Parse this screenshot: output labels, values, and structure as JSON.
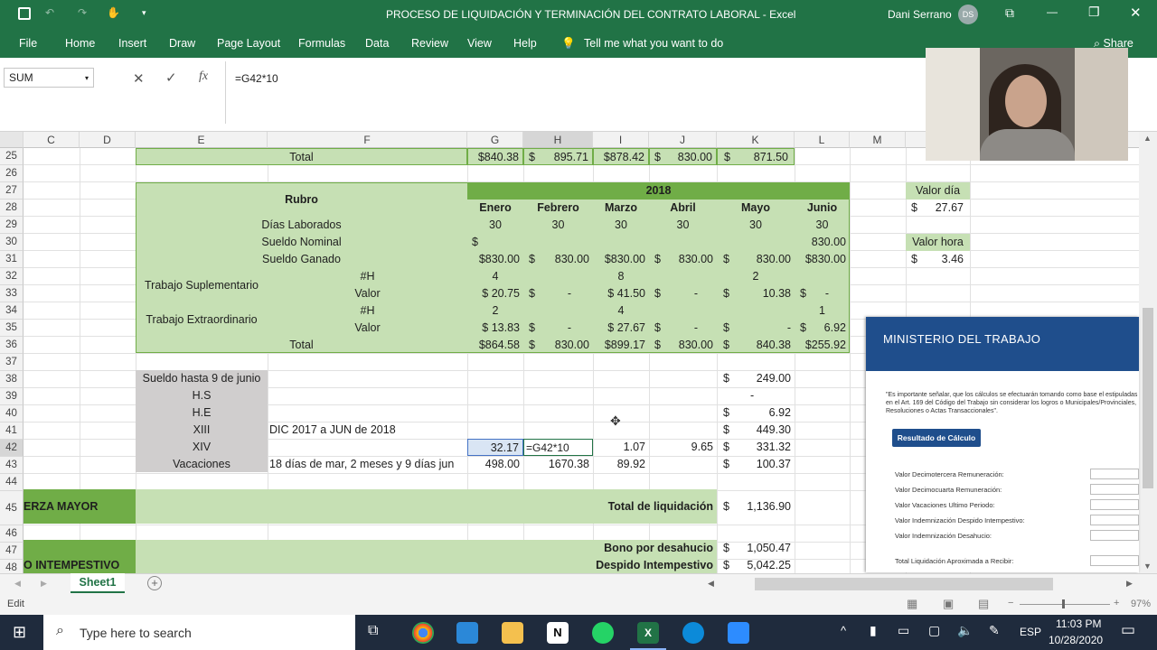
{
  "title": {
    "doc": "PROCESO DE LIQUIDACIÓN Y TERMINACIÓN DEL CONTRATO LABORAL",
    "sep": "-",
    "app": "Excel",
    "user": "Dani Serrano",
    "initials": "DS"
  },
  "menu": [
    "File",
    "Home",
    "Insert",
    "Draw",
    "Page Layout",
    "Formulas",
    "Data",
    "Review",
    "View",
    "Help"
  ],
  "tell_me": "Tell me what you want to do",
  "share": "Share",
  "namebox": "SUM",
  "formula": "=G42*10",
  "columns": [
    "C",
    "D",
    "E",
    "F",
    "G",
    "H",
    "I",
    "J",
    "K",
    "L",
    "M"
  ],
  "rows": [
    "25",
    "26",
    "27",
    "28",
    "29",
    "30",
    "31",
    "32",
    "33",
    "34",
    "35",
    "36",
    "37",
    "38",
    "39",
    "40",
    "41",
    "42",
    "43",
    "44",
    "45",
    "46",
    "47",
    "48"
  ],
  "cells": {
    "r25_total": "Total",
    "r25_g": "$840.38",
    "r25_h1": "$",
    "r25_h2": "895.71",
    "r25_i": "$878.42",
    "r25_j1": "$",
    "r25_j2": "830.00",
    "r25_k1": "$",
    "r25_k2": "871.50",
    "rubro": "Rubro",
    "year": "2018",
    "months": [
      "Enero",
      "Febrero",
      "Marzo",
      "Abril",
      "Mayo",
      "Junio"
    ],
    "dias_lab": "Días Laborados",
    "dias_vals": [
      "30",
      "30",
      "30",
      "30",
      "30",
      "30"
    ],
    "sueldo_nom": "Sueldo Nominal",
    "sn_dollar": "$",
    "sn_val": "830.00",
    "sueldo_gan": "Sueldo Ganado",
    "sg": [
      "$830.00",
      "$",
      "830.00",
      "$830.00",
      "$",
      "830.00",
      "$",
      "830.00",
      "$830.00"
    ],
    "trab_sup": "Trabajo Suplementario",
    "trab_ext": "Trabajo Extraordinario",
    "hh": "#H",
    "valor": "Valor",
    "r32": [
      "4",
      "8",
      "2"
    ],
    "r33": [
      "$ 20.75",
      "$",
      "-",
      "$ 41.50",
      "$",
      "-",
      "$",
      "10.38",
      "$",
      "-"
    ],
    "r34": [
      "2",
      "4",
      "1"
    ],
    "r35": [
      "$ 13.83",
      "$",
      "-",
      "$ 27.67",
      "$",
      "-",
      "$",
      "-",
      "$",
      "6.92"
    ],
    "r36_total": "Total",
    "r36": [
      "$864.58",
      "$",
      "830.00",
      "$899.17",
      "$",
      "830.00",
      "$",
      "840.38",
      "$255.92"
    ],
    "valor_dia": "Valor día",
    "vd1": "$",
    "vd2": "27.67",
    "valor_hora": "Valor hora",
    "vh1": "$",
    "vh2": "3.46",
    "l38": "Sueldo hasta 9 de junio",
    "k38a": "$",
    "k38b": "249.00",
    "l39": "H.S",
    "k39": "-",
    "l40": "H.E",
    "k40a": "$",
    "k40b": "6.92",
    "l41": "XIII",
    "f41": "DIC 2017 a JUN de 2018",
    "k41a": "$",
    "k41b": "449.30",
    "l42": "XIV",
    "g42": "32.17",
    "h42": "=G42*10",
    "i42": "1.07",
    "j42": "9.65",
    "k42a": "$",
    "k42b": "331.32",
    "l43": "Vacaciones",
    "f43": "18 días de mar, 2 meses y 9 días jun",
    "g43": "498.00",
    "h43": "1670.38",
    "i43": "89.92",
    "k43a": "$",
    "k43b": "100.37",
    "fuerza": "ERZA MAYOR",
    "total_liq": "Total de liquidación",
    "tl1": "$",
    "tl2": "1,136.90",
    "bono": "Bono por desahucio",
    "b1": "$",
    "b2": "1,050.47",
    "intemp": "O INTEMPESTIVO",
    "despido": "Despido Intempestivo",
    "d1": "$",
    "d2": "5,042.25"
  },
  "sheet_tab": "Sheet1",
  "status_mode": "Edit",
  "zoom": "97%",
  "ministerio": {
    "header": "MINISTERIO DEL TRABAJO",
    "note": "\"Es importante señalar, que los cálculos se efectuarán tomando como base el estipuladas en el Art. 169 del Código del Trabajo sin considerar los logros o Municipales/Provinciales, Resoluciones o Actas Transaccionales\".",
    "button": "Resultado de Cálculo",
    "fields": [
      "Valor Decimotercera Remuneración:",
      "Valor Decimocuarta Remuneración:",
      "Valor Vacaciones Ultimo Periodo:",
      "Valor Indemnización Despido Intempestivo:",
      "Valor Indemnización Desahucio:"
    ],
    "total": "Total Liquidación Aproximada a Recibir:"
  },
  "taskbar": {
    "search": "Type here to search",
    "lang": "ESP",
    "time": "11:03 PM",
    "date": "10/28/2020"
  },
  "colors": {
    "excel_green": "#217346",
    "header_green": "#70ad47",
    "light_green": "#c6e0b4",
    "gray": "#d0cece"
  }
}
